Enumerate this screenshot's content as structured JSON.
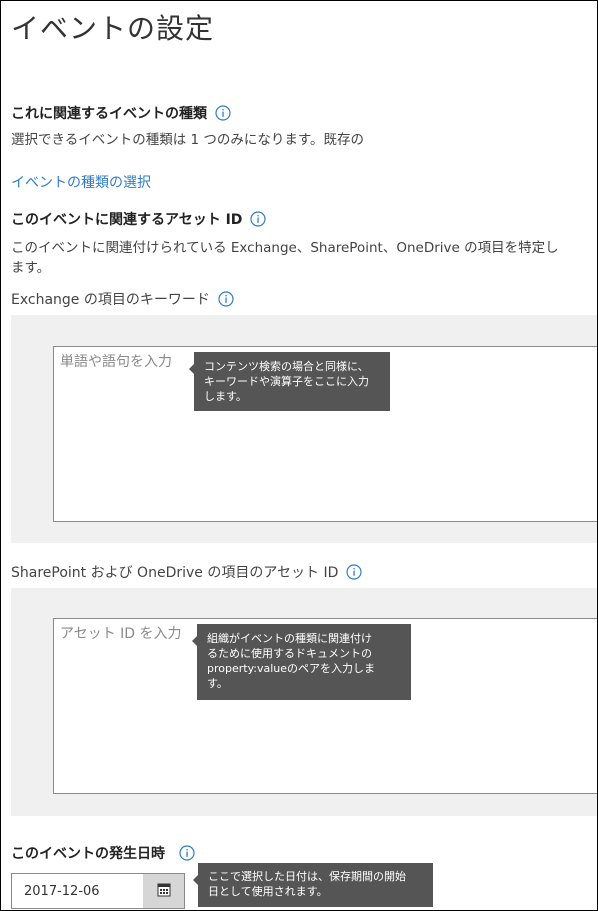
{
  "page": {
    "title": "イベントの設定"
  },
  "event_type_section": {
    "heading": "これに関連するイベントの種類",
    "description": "選択できるイベントの種類は 1 つのみになります。既存の",
    "select_link": "イベントの種類の選択"
  },
  "asset_id_section": {
    "heading": "このイベントに関連するアセット ID",
    "description_line1": "このイベントに関連付けられている Exchange、SharePoint、OneDrive の項目を特定し",
    "description_line2": "ます。"
  },
  "exchange_keywords": {
    "label": "Exchange の項目のキーワード",
    "placeholder": "単語や語句を入力",
    "tooltip_lines": [
      "コンテンツ検索の場合と同様に、",
      "キーワードや演算子をここに入力",
      "します。"
    ]
  },
  "sharepoint_asset_ids": {
    "label": "SharePoint および OneDrive の項目のアセット ID",
    "placeholder": "アセット ID を入力",
    "tooltip_lines": [
      "組織がイベントの種類に関連付け",
      "るために使用するドキュメントの",
      "property:valueのペアを入力しま",
      "す。"
    ]
  },
  "event_date": {
    "heading": "このイベントの発生日時",
    "value": "2017-12-06",
    "tooltip_lines": [
      "ここで選択した日付は、保存期間の開始",
      "日として使用されます。"
    ]
  },
  "icons": {
    "info": "info-icon",
    "calendar": "calendar-icon"
  },
  "colors": {
    "link": "#2f7dc9",
    "info_icon": "#2f7dc9",
    "panel_bg": "#f0f0f0",
    "tooltip_bg": "#555555"
  }
}
